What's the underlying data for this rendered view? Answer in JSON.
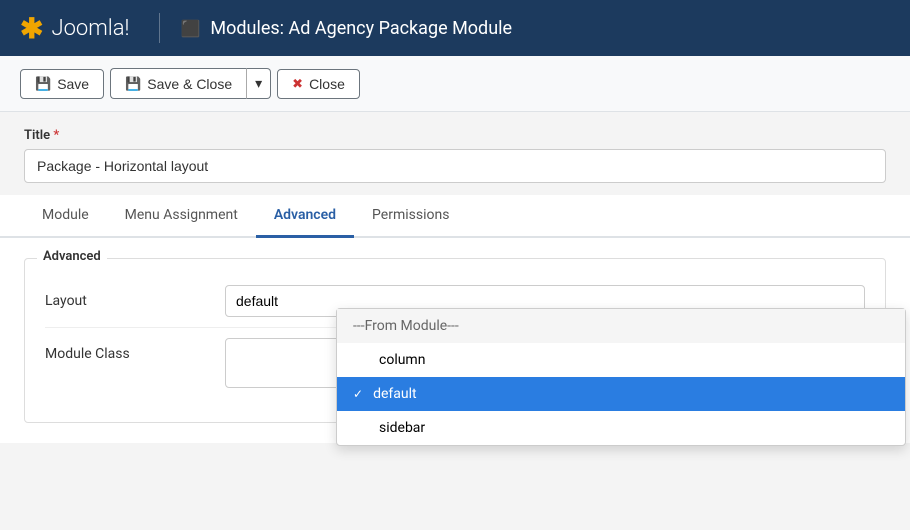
{
  "header": {
    "logo_text": "Joomla!",
    "module_icon": "☰",
    "title": "Modules: Ad Agency Package Module"
  },
  "toolbar": {
    "save_label": "Save",
    "save_close_label": "Save & Close",
    "close_label": "Close"
  },
  "title_section": {
    "label": "Title",
    "required": "*",
    "value": "Package - Horizontal layout",
    "placeholder": ""
  },
  "tabs": [
    {
      "id": "module",
      "label": "Module",
      "active": false
    },
    {
      "id": "menu-assignment",
      "label": "Menu Assignment",
      "active": false
    },
    {
      "id": "advanced",
      "label": "Advanced",
      "active": true
    },
    {
      "id": "permissions",
      "label": "Permissions",
      "active": false
    }
  ],
  "fieldset": {
    "legend": "Advanced",
    "fields": [
      {
        "id": "layout",
        "label": "Layout"
      },
      {
        "id": "module-class",
        "label": "Module Class"
      }
    ]
  },
  "layout_dropdown": {
    "group_header": "---From Module---",
    "options": [
      {
        "value": "column",
        "label": "column",
        "selected": false
      },
      {
        "value": "default",
        "label": "default",
        "selected": true
      },
      {
        "value": "sidebar",
        "label": "sidebar",
        "selected": false
      }
    ]
  }
}
